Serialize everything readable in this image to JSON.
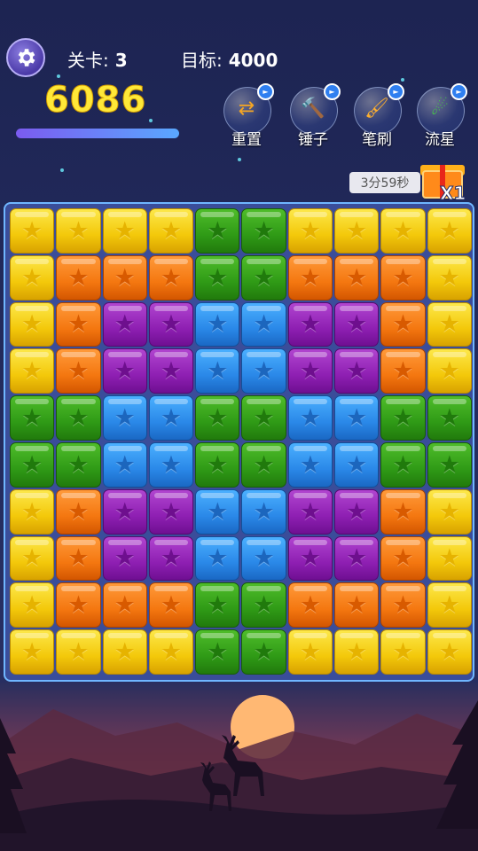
{
  "header": {
    "level_label": "关卡:",
    "level_value": "3",
    "target_label": "目标:",
    "target_value": "4000",
    "score": "6086",
    "progress": 1.0
  },
  "tools": [
    {
      "id": "reset",
      "label": "重置",
      "icon": "swap-arrows-icon",
      "glyph": "⇄",
      "glyph_color": "#f5a623"
    },
    {
      "id": "hammer",
      "label": "锤子",
      "icon": "hammer-icon",
      "glyph": "🔨",
      "glyph_color": "#e23b3b"
    },
    {
      "id": "brush",
      "label": "笔刷",
      "icon": "paintbrush-icon",
      "glyph": "🖌",
      "glyph_color": "#ffb02e"
    },
    {
      "id": "meteor",
      "label": "流星",
      "icon": "meteor-icon",
      "glyph": "☄",
      "glyph_color": "#44cc44"
    }
  ],
  "reward": {
    "timer": "3分59秒",
    "count": "X1",
    "icon": "gift-box-icon"
  },
  "board": {
    "colors": {
      "Y": "yellow",
      "O": "orange",
      "P": "purple",
      "B": "blue",
      "G": "green"
    },
    "rows": [
      [
        "Y",
        "Y",
        "Y",
        "Y",
        "G",
        "G",
        "Y",
        "Y",
        "Y",
        "Y"
      ],
      [
        "Y",
        "O",
        "O",
        "O",
        "G",
        "G",
        "O",
        "O",
        "O",
        "Y"
      ],
      [
        "Y",
        "O",
        "P",
        "P",
        "B",
        "B",
        "P",
        "P",
        "O",
        "Y"
      ],
      [
        "Y",
        "O",
        "P",
        "P",
        "B",
        "B",
        "P",
        "P",
        "O",
        "Y"
      ],
      [
        "G",
        "G",
        "B",
        "B",
        "G",
        "G",
        "B",
        "B",
        "G",
        "G"
      ],
      [
        "G",
        "G",
        "B",
        "B",
        "G",
        "G",
        "B",
        "B",
        "G",
        "G"
      ],
      [
        "Y",
        "O",
        "P",
        "P",
        "B",
        "B",
        "P",
        "P",
        "O",
        "Y"
      ],
      [
        "Y",
        "O",
        "P",
        "P",
        "B",
        "B",
        "P",
        "P",
        "O",
        "Y"
      ],
      [
        "Y",
        "O",
        "O",
        "O",
        "G",
        "G",
        "O",
        "O",
        "O",
        "Y"
      ],
      [
        "Y",
        "Y",
        "Y",
        "Y",
        "G",
        "G",
        "Y",
        "Y",
        "Y",
        "Y"
      ]
    ]
  },
  "theme": {
    "accent": "#ffe838",
    "board_border": "#6fb6ff"
  }
}
